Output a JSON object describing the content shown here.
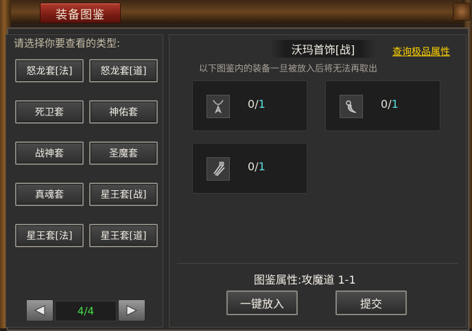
{
  "window": {
    "title": "装备图鉴"
  },
  "left": {
    "prompt": "请选择你要查看的类型:",
    "types": [
      "怒龙套[法]",
      "怒龙套[道]",
      "死卫套",
      "神佑套",
      "战神套",
      "圣魔套",
      "真魂套",
      "星王套[战]",
      "星王套[法]",
      "星王套[道]"
    ],
    "pager": {
      "current": "4",
      "separator": "/",
      "total": "4",
      "prev_icon": "left-arrow-icon",
      "next_icon": "right-arrow-icon"
    }
  },
  "right": {
    "set_title": "沃玛首饰[战]",
    "query_link": "查询极品属性",
    "notice": "以下图鉴内的装备一旦被放入后将无法再取出",
    "slots": [
      {
        "icon": "necklace-icon",
        "have": "0",
        "sep": "/",
        "need": "1"
      },
      {
        "icon": "horn-ring-icon",
        "have": "0",
        "sep": "/",
        "need": "1"
      },
      {
        "icon": "bracelet-icon",
        "have": "0",
        "sep": "/",
        "need": "1"
      }
    ],
    "attr_label": "图鉴属性:",
    "attr_value": "攻魔道 1-1",
    "btn_put_all": "一键放入",
    "btn_submit": "提交"
  },
  "colors": {
    "title_tab": "#7a1c14",
    "link": "#ffd200",
    "page_num": "#44dd44",
    "need_count": "#5ae0e0"
  }
}
